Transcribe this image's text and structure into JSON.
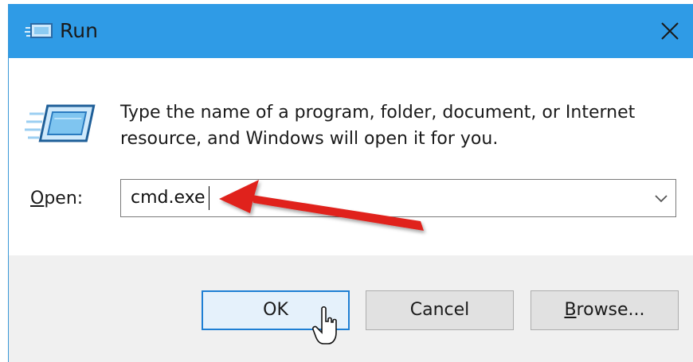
{
  "window": {
    "title": "Run",
    "title_icon": "run-app-icon",
    "close_icon": "close-icon"
  },
  "content": {
    "description": "Type the name of a program, folder, document, or Internet resource, and Windows will open it for you.",
    "open_label_accel": "O",
    "open_label_rest": "pen:",
    "open_value": "cmd.exe",
    "dropdown_icon": "chevron-down-icon"
  },
  "buttons": {
    "ok": "OK",
    "cancel": "Cancel",
    "browse_accel": "B",
    "browse_rest": "rowse..."
  },
  "annotations": {
    "arrow_color": "#e0201b"
  },
  "colors": {
    "titlebar": "#2f9be6",
    "ok_border": "#1e7fd4",
    "footer_bg": "#f0f0f0"
  }
}
